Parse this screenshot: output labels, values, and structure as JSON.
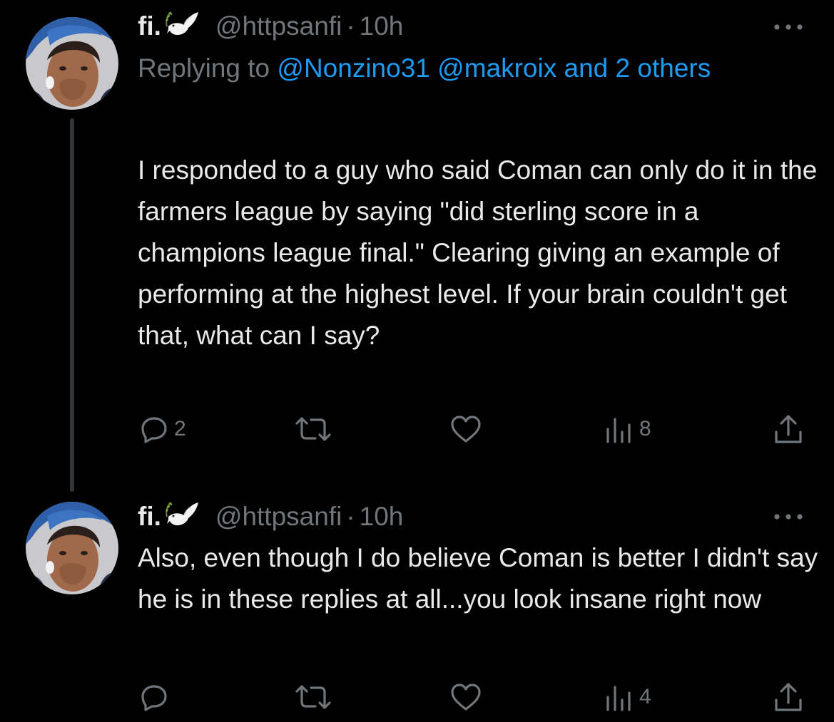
{
  "colors": {
    "background": "#000000",
    "text_primary": "#e7e9ea",
    "text_secondary": "#71767b",
    "accent": "#1d9bf0",
    "thread_line": "#333639"
  },
  "tweets": [
    {
      "avatar": "user-avatar-photo",
      "name": "fi.",
      "badge_icon": "dove-with-olive-branch-emoji",
      "handle": "@httpsanfi",
      "separator": "·",
      "time": "10h",
      "more_icon": "more-dots-icon",
      "replying_prefix": "Replying to ",
      "replying_mentions": "@Nonzino31 @makroix and 2 others",
      "text": "I responded to a guy who said Coman can only do it in the farmers league by saying \"did sterling score in a champions league final.\" Clearing giving an example of performing at the highest level. If your brain couldn't get that, what can I say?",
      "actions": {
        "reply": {
          "icon": "reply-icon",
          "count": "2"
        },
        "retweet": {
          "icon": "retweet-icon",
          "count": ""
        },
        "like": {
          "icon": "heart-icon",
          "count": ""
        },
        "views": {
          "icon": "views-icon",
          "count": "8"
        },
        "share": {
          "icon": "share-icon",
          "count": ""
        }
      }
    },
    {
      "avatar": "user-avatar-photo",
      "name": "fi.",
      "badge_icon": "dove-with-olive-branch-emoji",
      "handle": "@httpsanfi",
      "separator": "·",
      "time": "10h",
      "more_icon": "more-dots-icon",
      "text": "Also, even though I do believe Coman is better I didn't say he is in these replies at all...you look insane right now",
      "actions": {
        "reply": {
          "icon": "reply-icon",
          "count": ""
        },
        "retweet": {
          "icon": "retweet-icon",
          "count": ""
        },
        "like": {
          "icon": "heart-icon",
          "count": ""
        },
        "views": {
          "icon": "views-icon",
          "count": "4"
        },
        "share": {
          "icon": "share-icon",
          "count": ""
        }
      }
    }
  ]
}
